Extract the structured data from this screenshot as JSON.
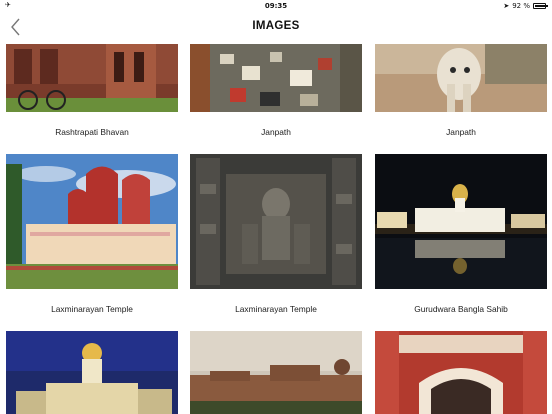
{
  "status_bar": {
    "airplane_icon": "airplane-icon",
    "time": "09:35",
    "battery_percent": "92 %",
    "battery_level": 0.92
  },
  "nav": {
    "title": "IMAGES",
    "back_icon": "chevron-left-icon"
  },
  "images": [
    {
      "caption": "Rashtrapati Bhavan"
    },
    {
      "caption": "Janpath"
    },
    {
      "caption": "Janpath"
    },
    {
      "caption": "Laxminarayan Temple"
    },
    {
      "caption": "Laxminarayan Temple"
    },
    {
      "caption": "Gurudwara Bangla Sahib"
    },
    {
      "caption": ""
    },
    {
      "caption": ""
    },
    {
      "caption": ""
    }
  ]
}
